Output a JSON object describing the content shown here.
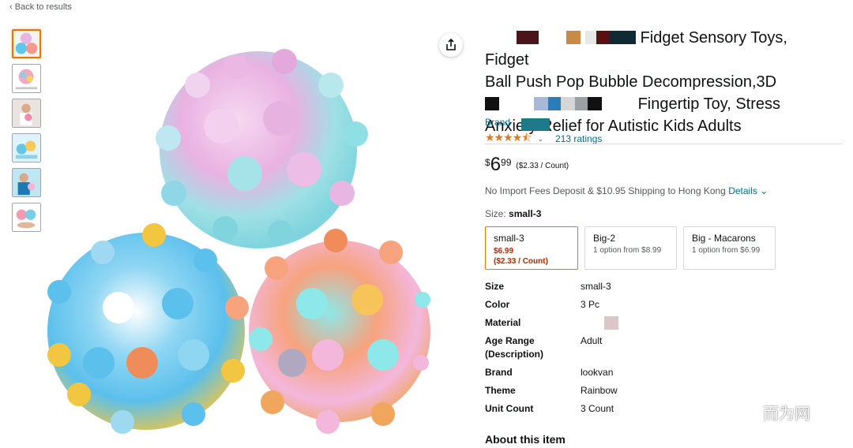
{
  "nav": {
    "back_label": "Back to results",
    "back_icon": "chevron-left-icon"
  },
  "thumbnails": [
    {
      "name": "thumb-1",
      "active": true
    },
    {
      "name": "thumb-2",
      "active": false
    },
    {
      "name": "thumb-3",
      "active": false
    },
    {
      "name": "thumb-4",
      "active": false
    },
    {
      "name": "thumb-5",
      "active": false
    },
    {
      "name": "thumb-6",
      "active": false
    }
  ],
  "share": {
    "icon": "share-icon"
  },
  "product": {
    "title_line1_tail": "Fidget Sensory Toys, Fidget",
    "title_line2": "Ball Push Pop Bubble Decompression,3D",
    "title_line3_tail": "Fingertip Toy, Stress",
    "title_line4": "Anxiety Relief for Autistic Kids Adults",
    "brand_prefix": "Brand",
    "rating_stars": "★★★★⯪",
    "ratings_count": "213 ratings",
    "price_symbol": "$",
    "price_whole": "6",
    "price_fraction": "99",
    "price_per_unit": "($2.33 / Count)",
    "shipping_text": "No Import Fees Deposit & $10.95 Shipping to Hong Kong ",
    "shipping_details": "Details",
    "size_label": "Size: ",
    "size_value": "small-3"
  },
  "swatches": [
    {
      "name": "small-3",
      "price": "$6.99",
      "unit": "($2.33 / Count)",
      "selected": true
    },
    {
      "name": "Big-2",
      "sub": "1 option from $8.99",
      "selected": false
    },
    {
      "name": "Big - Macarons",
      "sub": "1 option from $6.99",
      "selected": false
    }
  ],
  "specs": [
    {
      "key": "Size",
      "value": "small-3"
    },
    {
      "key": "Color",
      "value": "3 Pc"
    },
    {
      "key": "Material",
      "value": ""
    },
    {
      "key": "Age Range (Description)",
      "value": "Adult"
    },
    {
      "key": "Brand",
      "value": "lookvan"
    },
    {
      "key": "Theme",
      "value": "Rainbow"
    },
    {
      "key": "Unit Count",
      "value": "3 Count"
    }
  ],
  "about_heading": "About this item",
  "watermark": {
    "text": "而为网",
    "icon": "wechat-icon"
  },
  "colors": {
    "accent_orange": "#e77600",
    "link_teal": "#007185",
    "price_red": "#b12704",
    "star": "#de7921"
  }
}
